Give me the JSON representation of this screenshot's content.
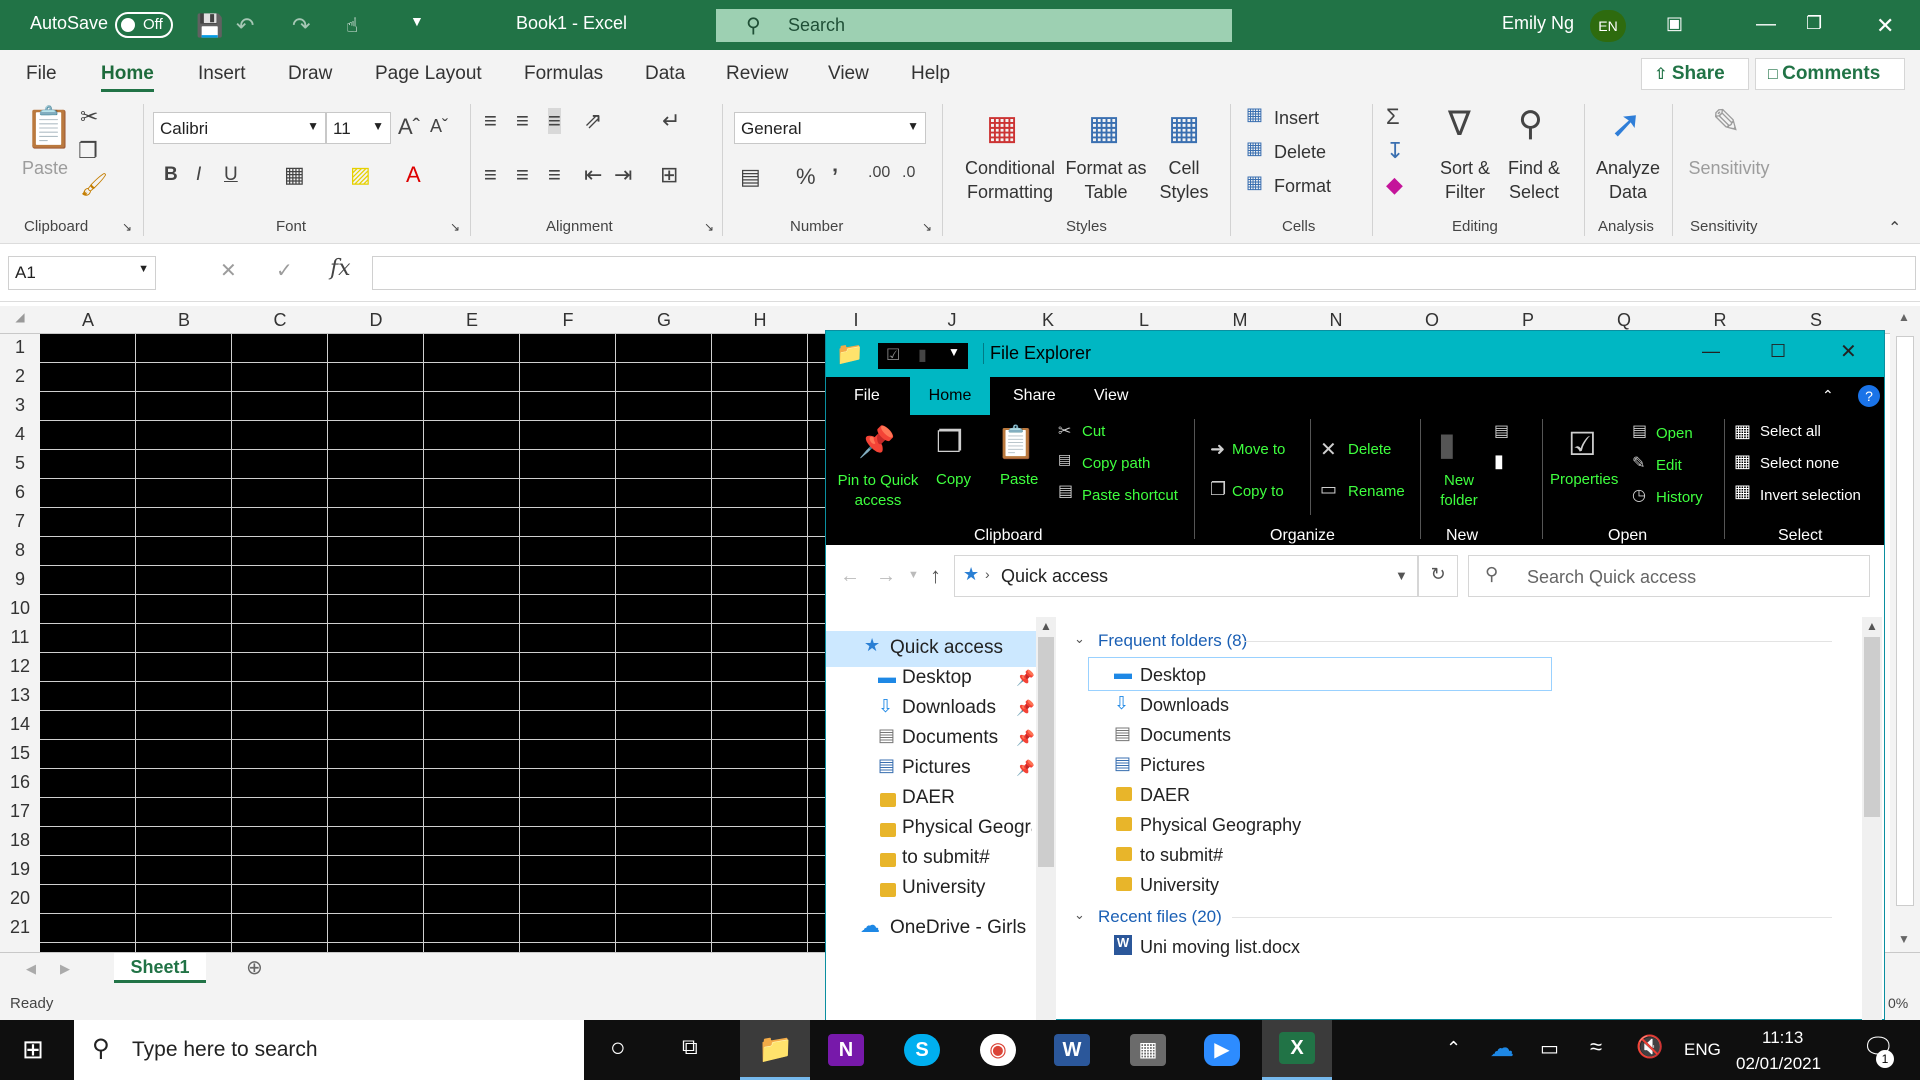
{
  "excel": {
    "title": {
      "autosave": "AutoSave",
      "autosave_state": "Off",
      "doc_title": "Book1  -  Excel",
      "search": "Search",
      "user": "Emily Ng",
      "initials": "EN"
    },
    "tabs": [
      "File",
      "Home",
      "Insert",
      "Draw",
      "Page Layout",
      "Formulas",
      "Data",
      "Review",
      "View",
      "Help"
    ],
    "share": "Share",
    "comments": "Comments",
    "ribbon": {
      "clipboard": {
        "paste": "Paste",
        "group": "Clipboard"
      },
      "font": {
        "name": "Calibri",
        "size": "11",
        "group": "Font"
      },
      "alignment": {
        "group": "Alignment"
      },
      "number": {
        "format": "General",
        "group": "Number"
      },
      "styles": {
        "conditional_1": "Conditional",
        "conditional_2": "Formatting",
        "format_as_1": "Format as",
        "format_as_2": "Table",
        "cell_styles_1": "Cell",
        "cell_styles_2": "Styles",
        "group": "Styles"
      },
      "cells": {
        "insert": "Insert",
        "delete": "Delete",
        "format": "Format",
        "group": "Cells"
      },
      "editing": {
        "sort_1": "Sort &",
        "sort_2": "Filter",
        "find_1": "Find &",
        "find_2": "Select",
        "group": "Editing"
      },
      "analysis": {
        "analyze_1": "Analyze",
        "analyze_2": "Data",
        "group": "Analysis"
      },
      "sensitivity": {
        "label": "Sensitivity",
        "group": "Sensitivity"
      }
    },
    "name_box": "A1",
    "fx": "fx",
    "columns": [
      "A",
      "B",
      "C",
      "D",
      "E",
      "F",
      "G",
      "H",
      "I",
      "J",
      "K",
      "L",
      "M",
      "N",
      "O",
      "P",
      "Q",
      "R",
      "S"
    ],
    "rows": [
      "1",
      "2",
      "3",
      "4",
      "5",
      "6",
      "7",
      "8",
      "9",
      "10",
      "11",
      "12",
      "13",
      "14",
      "15",
      "16",
      "17",
      "18",
      "19",
      "20",
      "21"
    ],
    "sheet_tab": "Sheet1",
    "status": "Ready",
    "zoom_fragment": "0%"
  },
  "explorer": {
    "title": "File Explorer",
    "tabs": [
      "File",
      "Home",
      "Share",
      "View"
    ],
    "ribbon": {
      "pin_1": "Pin to Quick",
      "pin_2": "access",
      "copy": "Copy",
      "paste": "Paste",
      "cut": "Cut",
      "copy_path": "Copy path",
      "paste_shortcut": "Paste shortcut",
      "clipboard_group": "Clipboard",
      "move_to": "Move to",
      "copy_to": "Copy to",
      "delete": "Delete",
      "rename": "Rename",
      "organize_group": "Organize",
      "new_folder_1": "New",
      "new_folder_2": "folder",
      "new_group": "New",
      "properties": "Properties",
      "open": "Open",
      "edit": "Edit",
      "history": "History",
      "open_group": "Open",
      "select_all": "Select all",
      "select_none": "Select none",
      "invert": "Invert selection",
      "select_group": "Select"
    },
    "address": "Quick access",
    "search_placeholder": "Search Quick access",
    "nav": {
      "quick_access": "Quick access",
      "items": [
        "Desktop",
        "Downloads",
        "Documents",
        "Pictures",
        "DAER",
        "Physical Geograp",
        "to submit#",
        "University"
      ],
      "onedrive": "OneDrive - Girls D"
    },
    "content": {
      "frequent_header": "Frequent folders (8)",
      "folders": [
        "Desktop",
        "Downloads",
        "Documents",
        "Pictures",
        "DAER",
        "Physical Geography",
        "to submit#",
        "University"
      ],
      "recent_header": "Recent files (20)",
      "recent": [
        "Uni moving list.docx"
      ]
    }
  },
  "taskbar": {
    "search": "Type here to search",
    "lang": "ENG",
    "time": "11:13",
    "date": "02/01/2021",
    "notif_count": "1"
  }
}
